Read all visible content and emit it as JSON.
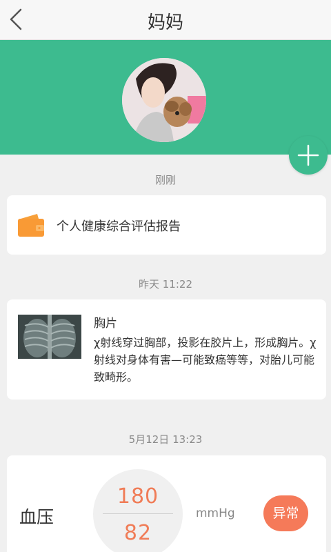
{
  "header": {
    "title": "妈妈"
  },
  "feed": {
    "items": [
      {
        "time": "刚刚",
        "title": "个人健康综合评估报告"
      },
      {
        "time": "昨天 11:22",
        "title": "胸片",
        "description": "χ射线穿过胸部，投影在胶片上，形成胸片。χ射线对身体有害—可能致癌等等，对胎儿可能致畸形。"
      },
      {
        "time": "5月12日 13:23",
        "label": "血压",
        "systolic": "180",
        "diastolic": "82",
        "unit": "mmHg",
        "status": "异常"
      }
    ]
  },
  "icons": {
    "back": "chevron-left-icon",
    "add": "plus-icon",
    "report": "wallet-icon"
  },
  "colors": {
    "accent": "#3dbb8f",
    "alert": "#f57a59",
    "value": "#f07c57"
  }
}
